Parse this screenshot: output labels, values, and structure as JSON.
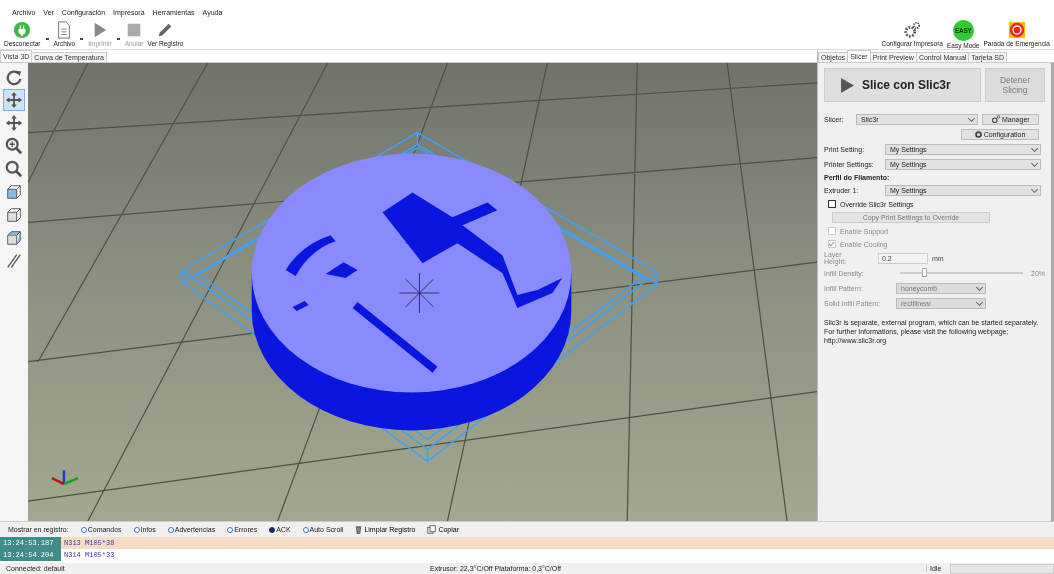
{
  "menu": [
    "Archivo",
    "Ver",
    "Configuración",
    "Impresora",
    "Herramientas",
    "Ayuda"
  ],
  "toolbar_left": [
    {
      "label": "Desconectar",
      "kind": "plug",
      "disabled": false,
      "dropdown": true
    },
    {
      "label": "Archivo",
      "kind": "document",
      "disabled": false,
      "dropdown": true
    },
    {
      "label": "Imprimir",
      "kind": "play",
      "disabled": true,
      "dropdown": true
    },
    {
      "label": "Anular",
      "kind": "stop",
      "disabled": true,
      "dropdown": false
    },
    {
      "label": "Ver Registro",
      "kind": "pencil",
      "disabled": false,
      "dropdown": false
    }
  ],
  "toolbar_right": [
    {
      "label": "Configurar Impresora",
      "kind": "gears"
    },
    {
      "label": "Easy Mode",
      "kind": "easy",
      "badge": "EASY"
    },
    {
      "label": "Parada de Emergencia",
      "kind": "emergency"
    }
  ],
  "view_tabs": [
    {
      "label": "Vista 3D",
      "selected": true
    },
    {
      "label": "Curva de Temperatura",
      "selected": false
    }
  ],
  "view_tools": [
    {
      "kind": "rotate",
      "selected": false
    },
    {
      "kind": "move",
      "selected": true
    },
    {
      "kind": "pan",
      "selected": false
    },
    {
      "kind": "zoom-in",
      "selected": false
    },
    {
      "kind": "zoom-fit",
      "selected": false
    },
    {
      "kind": "view-iso",
      "selected": false
    },
    {
      "kind": "view-front",
      "selected": false
    },
    {
      "kind": "view-top",
      "selected": false
    },
    {
      "kind": "parallel",
      "selected": false
    }
  ],
  "panel_tabs": [
    {
      "label": "Objetos",
      "selected": false
    },
    {
      "label": "Slicer",
      "selected": true
    },
    {
      "label": "Print Preview",
      "selected": false
    },
    {
      "label": "Control Manual",
      "selected": false
    },
    {
      "label": "Tarjeta SD",
      "selected": false
    }
  ],
  "slice_button": "Slice con Slic3r",
  "stop_button": {
    "label": "Detener Slicing",
    "disabled": true
  },
  "slicer": {
    "label": "Slicer:",
    "value": "Slic3r",
    "manager": "Manager",
    "configuration": "Configuration"
  },
  "settings": [
    {
      "label": "Print Setting:",
      "value": "My Settings"
    },
    {
      "label": "Printer Settings:",
      "value": "My Settings"
    }
  ],
  "filament_heading": "Perfil do Filamento:",
  "extruders": [
    {
      "label": "Extruder 1:",
      "value": "My Settings"
    }
  ],
  "override": {
    "label": "Override Slic3r Settings",
    "checked": false
  },
  "copy_button": {
    "label": "Copy Print Settings to Override",
    "disabled": true
  },
  "options": [
    {
      "label": "Enable Support",
      "checked": false,
      "disabled": true
    },
    {
      "label": "Enable Cooling",
      "checked": true,
      "disabled": true
    }
  ],
  "layer_height": {
    "label": "Layer Height:",
    "value": "0.2",
    "unit": "mm",
    "disabled": true
  },
  "infill_density": {
    "label": "Infill Density:",
    "level": 0.2,
    "reading": "20%",
    "disabled": true
  },
  "patterns": [
    {
      "label": "Infill Pattern:",
      "value": "honeycomb",
      "disabled": true
    },
    {
      "label": "Solid Infill Pattern:",
      "value": "rectilinear",
      "disabled": true
    }
  ],
  "note": "Slic3r is separate, external program, which can be started separately. For further informations, please visit the following webpage: http://www.slic3r.org",
  "log_filter": {
    "label": "Mostrar en registro:",
    "options": [
      {
        "label": "Comandos",
        "selected": false
      },
      {
        "label": "Infos",
        "selected": false
      },
      {
        "label": "Advertencias",
        "selected": false
      },
      {
        "label": "Errores",
        "selected": false
      },
      {
        "label": "ACK",
        "selected": true
      },
      {
        "label": "Auto Scroll",
        "selected": false
      }
    ],
    "buttons": [
      {
        "label": "Limpiar Registro",
        "kind": "trash"
      },
      {
        "label": "Copiar",
        "kind": "copy"
      }
    ]
  },
  "log_rows": [
    {
      "time": "13:24:53.187",
      "text": "N313 M105*38",
      "selected": true
    },
    {
      "time": "13:24:54.204",
      "text": "N314 M105*33",
      "selected": false
    }
  ],
  "status_bar": {
    "connection": "Connected: default",
    "temperatures": "Extrusor: 22,3°C/Off Plataforma: 0,3°C/Off",
    "state": "Idle"
  }
}
